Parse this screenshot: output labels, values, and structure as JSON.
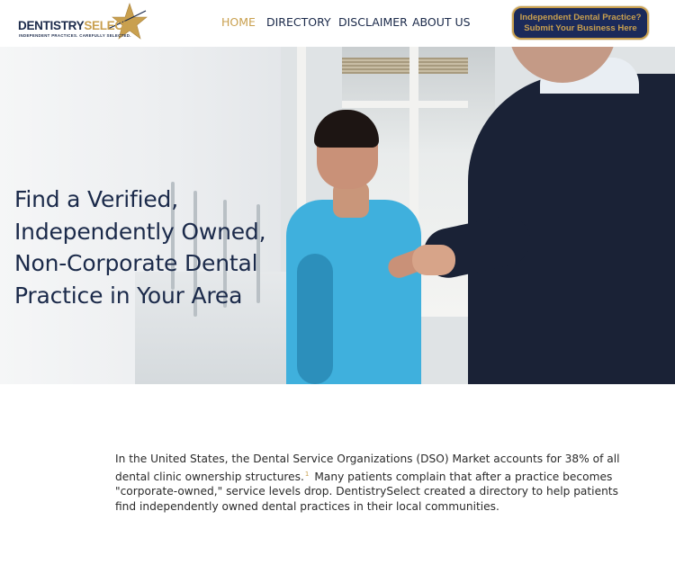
{
  "logo": {
    "name_part1": "DENTISTRY",
    "name_part2": "SELECT",
    "tagline": "INDEPENDENT PRACTICES. CAREFULLY SELECTED.",
    "star_icon": "star-icon",
    "colors": {
      "navy": "#1b2a4a",
      "gold": "#c9a04f"
    }
  },
  "nav": {
    "items": [
      {
        "label": "HOME",
        "active": true
      },
      {
        "label": "DIRECTORY",
        "active": false
      },
      {
        "label": "DISCLAIMER",
        "active": false
      },
      {
        "label": "ABOUT US",
        "active": false
      }
    ]
  },
  "cta": {
    "line1": "Independent Dental Practice?",
    "line2": "Submit Your Business Here"
  },
  "hero": {
    "title_lines": [
      "Find a Verified,",
      "Independently Owned,",
      "Non-Corporate Dental",
      "Practice in Your Area"
    ]
  },
  "intro": {
    "line1": "In the United States, the Dental Service Organizations (DSO) Market accounts for 38% of all",
    "line2a": "dental clinic ownership structures.",
    "footnote": "1",
    "line2b": "Many patients complain that after a practice becomes",
    "line3": "\"corporate-owned,\" service levels drop. DentistrySelect created a directory to help patients",
    "line4": "find independently owned dental practices in their local communities."
  }
}
